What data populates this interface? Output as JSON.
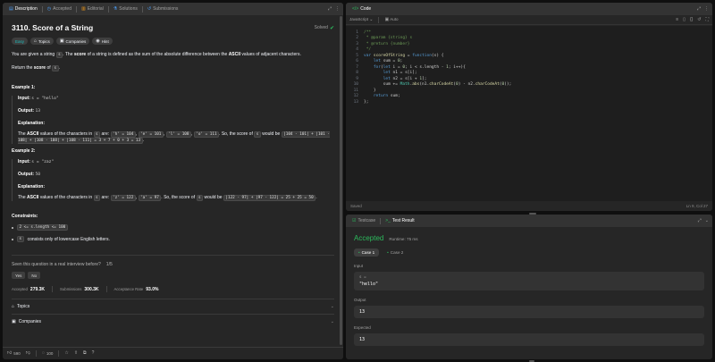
{
  "left_tabs": [
    {
      "icon": "doc-icon",
      "label": "Description",
      "active": true
    },
    {
      "icon": "clock-icon",
      "label": "Accepted"
    },
    {
      "icon": "book-icon",
      "label": "Editorial"
    },
    {
      "icon": "flask-icon",
      "label": "Solutions"
    },
    {
      "icon": "history-icon",
      "label": "Submissions"
    }
  ],
  "problem": {
    "title": "3110. Score of a String",
    "solved_label": "Solved",
    "chips": {
      "easy": "Easy",
      "topics": "Topics",
      "companies": "Companies",
      "hint": "Hint"
    },
    "desc": {
      "p1a": "You are given a string",
      "p1_s": "s",
      "p1b": ". The",
      "p1_score": "score",
      "p1c": "of a string is defined as the sum of the absolute difference between the",
      "p1_ascii": "ASCII",
      "p1d": "values of adjacent characters.",
      "p2a": "Return the",
      "p2_score": "score",
      "p2b": "of",
      "p2_s": "s",
      "p2c": "."
    },
    "ex1": {
      "title": "Example 1:",
      "input_label": "Input:",
      "input": "s = \"hello\"",
      "output_label": "Output:",
      "output": "13",
      "expl_label": "Explanation:",
      "e_a": "The",
      "e_ascii": "ASCII",
      "e_b": "values of the characters in",
      "e_s": "s",
      "e_c": "are:",
      "v1": "'h' = 104",
      "v2": "'e' = 101",
      "v3": "'l' = 108",
      "v4": "'o' = 111",
      "e_d": ". So, the score of",
      "e_s2": "s",
      "e_e": "would be",
      "calc1": "|104 - 101| + |101 - 108| + |108 - 108| + |108 - 111| = 3 + 7 + 0 + 3 = 13",
      "e_end": "."
    },
    "ex2": {
      "title": "Example 2:",
      "input_label": "Input:",
      "input": "s = \"zaz\"",
      "output_label": "Output:",
      "output": "50",
      "expl_label": "Explanation:",
      "e_a": "The",
      "e_ascii": "ASCII",
      "e_b": "values of the characters in",
      "e_s": "s",
      "e_c": "are:",
      "v1": "'z' = 122",
      "v2": "'a' = 97",
      "e_d": ". So, the score of",
      "e_s2": "s",
      "e_e": "would be",
      "calc": "|122 - 97| + |97 - 122| = 25 + 25 = 50",
      "e_end": "."
    },
    "constraints": {
      "title": "Constraints:",
      "c1": "2 <= s.length <= 100",
      "c2_code": "s",
      "c2": "consists only of lowercase English letters."
    },
    "seen": {
      "q": "Seen this question in a real interview before?",
      "count": "1/5",
      "yes": "Yes",
      "no": "No"
    },
    "stats": {
      "accepted_label": "Accepted",
      "accepted": "279.3K",
      "submissions_label": "Submissions",
      "submissions": "300.3K",
      "rate_label": "Acceptance Rate",
      "rate": "93.0%"
    },
    "accordions": {
      "topics": "Topics",
      "companies": "Companies"
    }
  },
  "footer": {
    "likes": "590",
    "comments": "100"
  },
  "code": {
    "tab": "Code",
    "language": "JavaScript",
    "mode": "Auto",
    "status_left": "Saved",
    "status_right": "Ln 9, Col 27",
    "lines": [
      "/**",
      " * @param {string} s",
      " * @return {number}",
      " */",
      "var scoreOfString = function(s) {",
      "    let sum = 0;",
      "    for(let i = 0; i < s.length - 1; i++){",
      "        let n1 = s[i];",
      "        let n2 = s[i + 1];",
      "        sum += Math.abs(n1.charCodeAt(0) - n2.charCodeAt(0));",
      "    }",
      "    return sum;",
      "};"
    ]
  },
  "result": {
    "tab_testcase": "Testcase",
    "tab_result": "Test Result",
    "status": "Accepted",
    "runtime": "Runtime: 75 ms",
    "cases": [
      "Case 1",
      "Case 2"
    ],
    "input_label": "Input",
    "input_var": "s =",
    "input_val": "\"hello\"",
    "output_label": "Output",
    "output_val": "13",
    "expected_label": "Expected",
    "expected_val": "13"
  },
  "colors": {
    "accepted": "#2cbb5d",
    "easy": "#1cbaba",
    "panel": "#262626",
    "background": "#0f0f0f"
  }
}
